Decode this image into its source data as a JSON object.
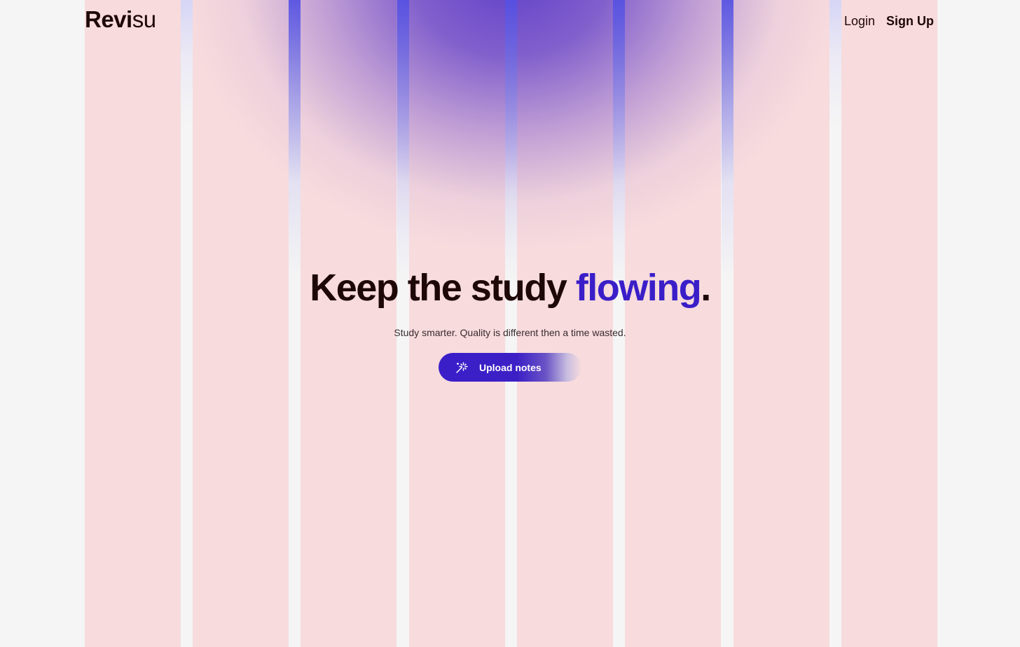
{
  "brand": {
    "name_bold": "Revi",
    "name_light": "su"
  },
  "nav": {
    "login_label": "Login",
    "signup_label": "Sign Up"
  },
  "hero": {
    "headline_main": "Keep the study ",
    "headline_accent": "flowing",
    "headline_end": ".",
    "subtitle": "Study smarter. Quality is different then a time wasted.",
    "cta_label": "Upload notes",
    "cta_icon": "magic-wand-icon"
  },
  "colors": {
    "text_dark": "#1e0707",
    "accent": "#3a1ec8",
    "column_pink": "#f7dbdd",
    "page_bg": "#f5f5f5",
    "glow_purple": "#5837c8"
  }
}
